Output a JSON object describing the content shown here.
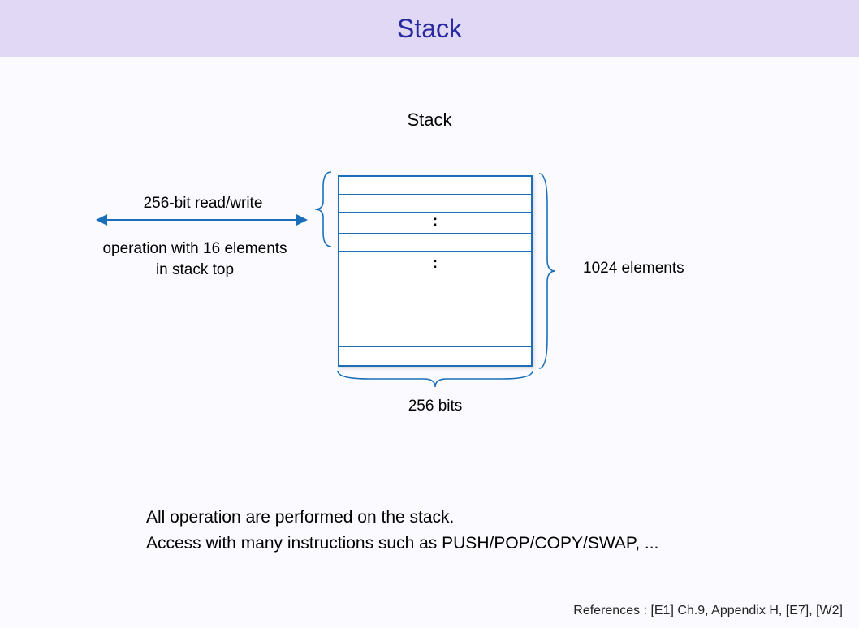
{
  "header": {
    "title": "Stack"
  },
  "diagram": {
    "title": "Stack",
    "dots1": ":",
    "dots2": ":",
    "rw_label": "256-bit read/write",
    "op_line1": "operation with 16 elements",
    "op_line2": "in stack top",
    "right_label": "1024 elements",
    "bottom_label": "256 bits"
  },
  "description": {
    "line1": "All operation are performed on the stack.",
    "line2": "Access with many instructions such as PUSH/POP/COPY/SWAP, ..."
  },
  "references": "References : [E1] Ch.9, Appendix H, [E7], [W2]"
}
